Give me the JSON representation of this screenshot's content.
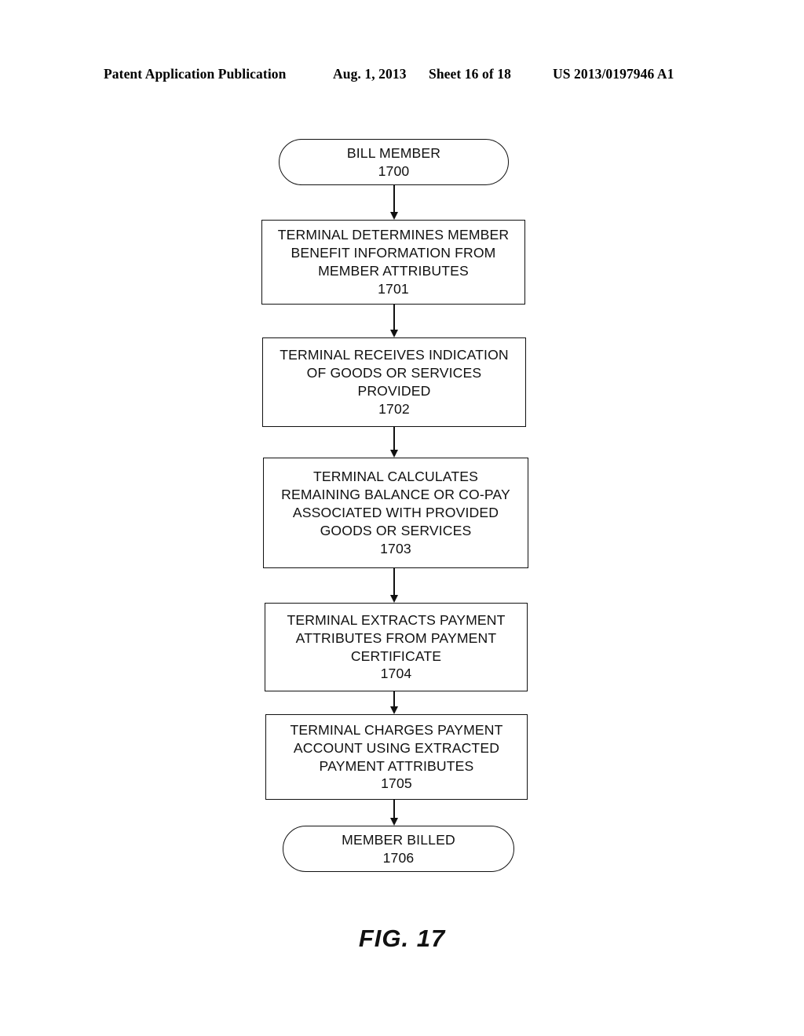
{
  "header": {
    "publication": "Patent Application Publication",
    "date": "Aug. 1, 2013",
    "sheet": "Sheet 16 of 18",
    "doc_number": "US 2013/0197946 A1"
  },
  "figure": {
    "caption": "FIG. 17",
    "nodes": [
      {
        "id": "1700",
        "shape": "terminator",
        "lines": [
          "BILL MEMBER",
          "1700"
        ]
      },
      {
        "id": "1701",
        "shape": "process",
        "lines": [
          "TERMINAL DETERMINES MEMBER",
          "BENEFIT INFORMATION FROM",
          "MEMBER ATTRIBUTES",
          "1701"
        ]
      },
      {
        "id": "1702",
        "shape": "process",
        "lines": [
          "TERMINAL RECEIVES INDICATION",
          "OF GOODS OR SERVICES",
          "PROVIDED",
          "1702"
        ]
      },
      {
        "id": "1703",
        "shape": "process",
        "lines": [
          "TERMINAL CALCULATES",
          "REMAINING BALANCE OR CO-PAY",
          "ASSOCIATED WITH PROVIDED",
          "GOODS OR SERVICES",
          "1703"
        ]
      },
      {
        "id": "1704",
        "shape": "process",
        "lines": [
          "TERMINAL EXTRACTS PAYMENT",
          "ATTRIBUTES FROM PAYMENT",
          "CERTIFICATE",
          "1704"
        ]
      },
      {
        "id": "1705",
        "shape": "process",
        "lines": [
          "TERMINAL CHARGES PAYMENT",
          "ACCOUNT USING EXTRACTED",
          "PAYMENT ATTRIBUTES",
          "1705"
        ]
      },
      {
        "id": "1706",
        "shape": "terminator",
        "lines": [
          "MEMBER BILLED",
          "1706"
        ]
      }
    ]
  }
}
